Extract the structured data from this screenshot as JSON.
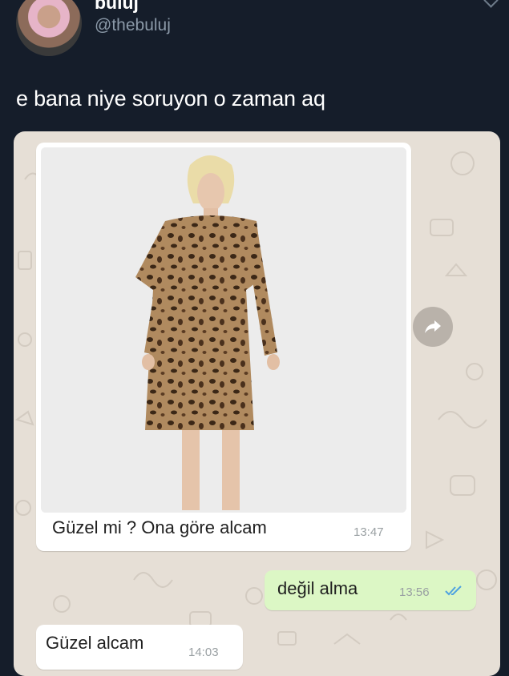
{
  "tweet": {
    "display_name": "buluj",
    "handle": "@thebuluj",
    "text": "e bana niye soruyon o zaman aq"
  },
  "chat": {
    "messages": [
      {
        "direction": "incoming",
        "has_image": true,
        "text": "Güzel mi ? Ona göre alcam",
        "time": "13:47"
      },
      {
        "direction": "outgoing",
        "text": "değil alma",
        "time": "13:56",
        "status": "read"
      },
      {
        "direction": "incoming",
        "text": "Güzel alcam",
        "time": "14:03"
      }
    ]
  },
  "colors": {
    "background": "#151d2a",
    "chat_wallpaper": "#e6dfd6",
    "outgoing_bubble": "#dcf7c5",
    "incoming_bubble": "#ffffff",
    "read_ticks": "#4fa3e0"
  },
  "icons": [
    "chevron-down-icon",
    "forward-icon",
    "double-check-icon"
  ]
}
